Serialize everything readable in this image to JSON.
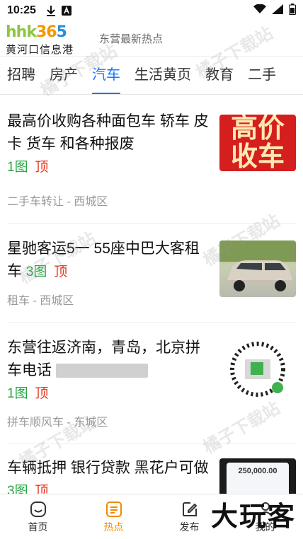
{
  "status_bar": {
    "time": "10:25"
  },
  "header": {
    "logo_mark": "hhk365",
    "logo_text": "黄河口信息港",
    "slogan": "东营最新热点"
  },
  "tabs": [
    {
      "label": "招聘"
    },
    {
      "label": "房产"
    },
    {
      "label": "汽车",
      "active": true
    },
    {
      "label": "生活黄页"
    },
    {
      "label": "教育"
    },
    {
      "label": "二手"
    }
  ],
  "items": [
    {
      "title": "最高价收购各种面包车 轿车 皮卡 货车 和各种报废",
      "pics": "1图",
      "top": "顶",
      "meta": "二手车转让 - 西城区",
      "thumb_text": [
        "高价",
        "收车"
      ]
    },
    {
      "title": "星驰客运5一 55座中巴大客租车",
      "pics": "3图",
      "top": "顶",
      "meta": "租车 - 西城区"
    },
    {
      "title": "东营往返济南，青岛，北京拼车电话",
      "pics": "1图",
      "top": "顶",
      "meta": "拼车顺风车 - 东城区"
    },
    {
      "title": "车辆抵押 银行贷款 黑花户可做",
      "pics": "3图",
      "top": "顶",
      "thumb_text": "250,000.00"
    }
  ],
  "watermark": "橘子下载站",
  "bottom_nav": [
    {
      "label": "首页",
      "icon": "home-icon"
    },
    {
      "label": "热点",
      "icon": "hot-icon",
      "active": true
    },
    {
      "label": "发布",
      "icon": "edit-icon"
    },
    {
      "label": "我的",
      "icon": "user-icon"
    }
  ],
  "corner_mark": "大玩客",
  "colors": {
    "accent_blue": "#1677ff",
    "active_orange": "#f08a00",
    "top_red": "#e8341c",
    "pics_green": "#28a745"
  }
}
